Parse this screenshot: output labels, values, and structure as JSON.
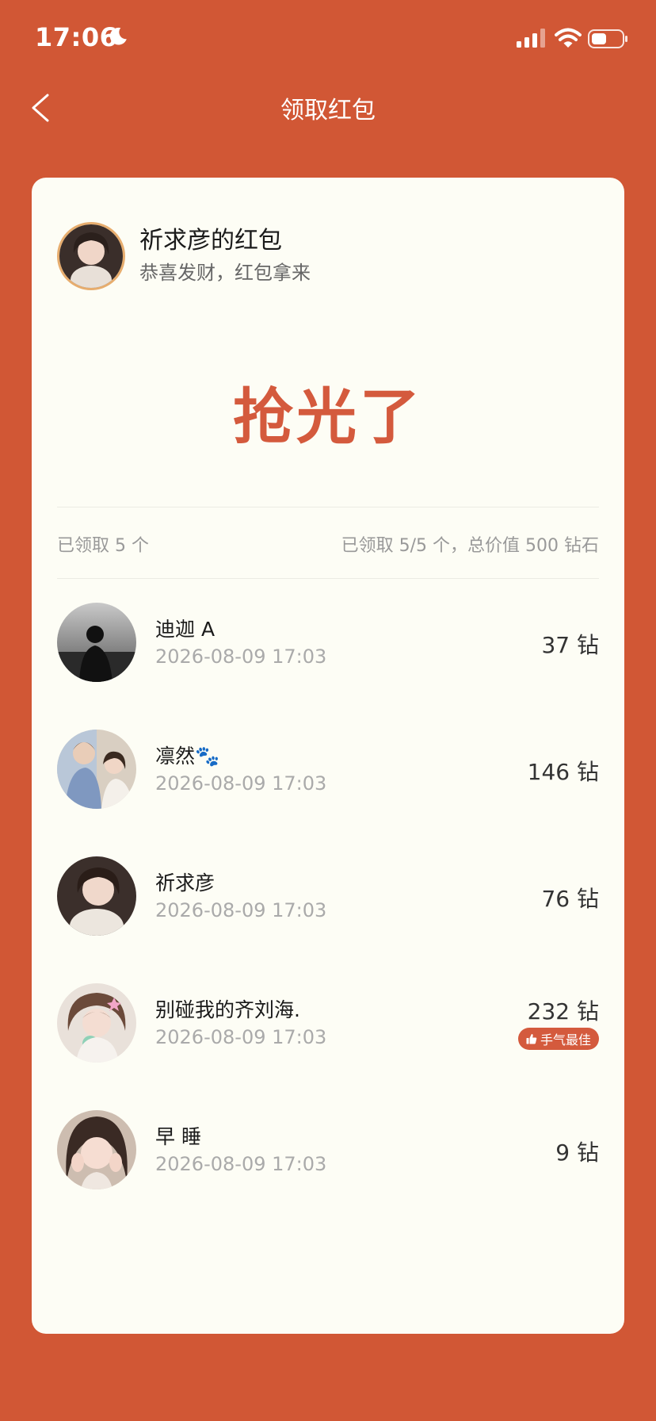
{
  "status_bar": {
    "time": "17:06"
  },
  "nav": {
    "title": "领取红包"
  },
  "sender": {
    "name": "祈求彦的红包",
    "message": "恭喜发财，红包拿来"
  },
  "status": "抢光了",
  "summary": {
    "left": "已领取 5 个",
    "right": "已领取 5/5 个，总价值 500 钻石"
  },
  "colors": {
    "background": "#D15735",
    "card": "#FDFDF5",
    "accent": "#D45A3D"
  },
  "recipients": [
    {
      "name": "迪迦 A",
      "time": "2026-08-09 17:03",
      "amount": "37 钻"
    },
    {
      "name": "凛然🐾",
      "time": "2026-08-09 17:03",
      "amount": "146 钻"
    },
    {
      "name": "祈求彦",
      "time": "2026-08-09 17:03",
      "amount": "76 钻"
    },
    {
      "name": "别碰我的齐刘海.",
      "time": "2026-08-09 17:03",
      "amount": "232 钻",
      "badge": "手气最佳"
    },
    {
      "name": "早 睡",
      "time": "2026-08-09 17:03",
      "amount": "9 钻"
    }
  ]
}
